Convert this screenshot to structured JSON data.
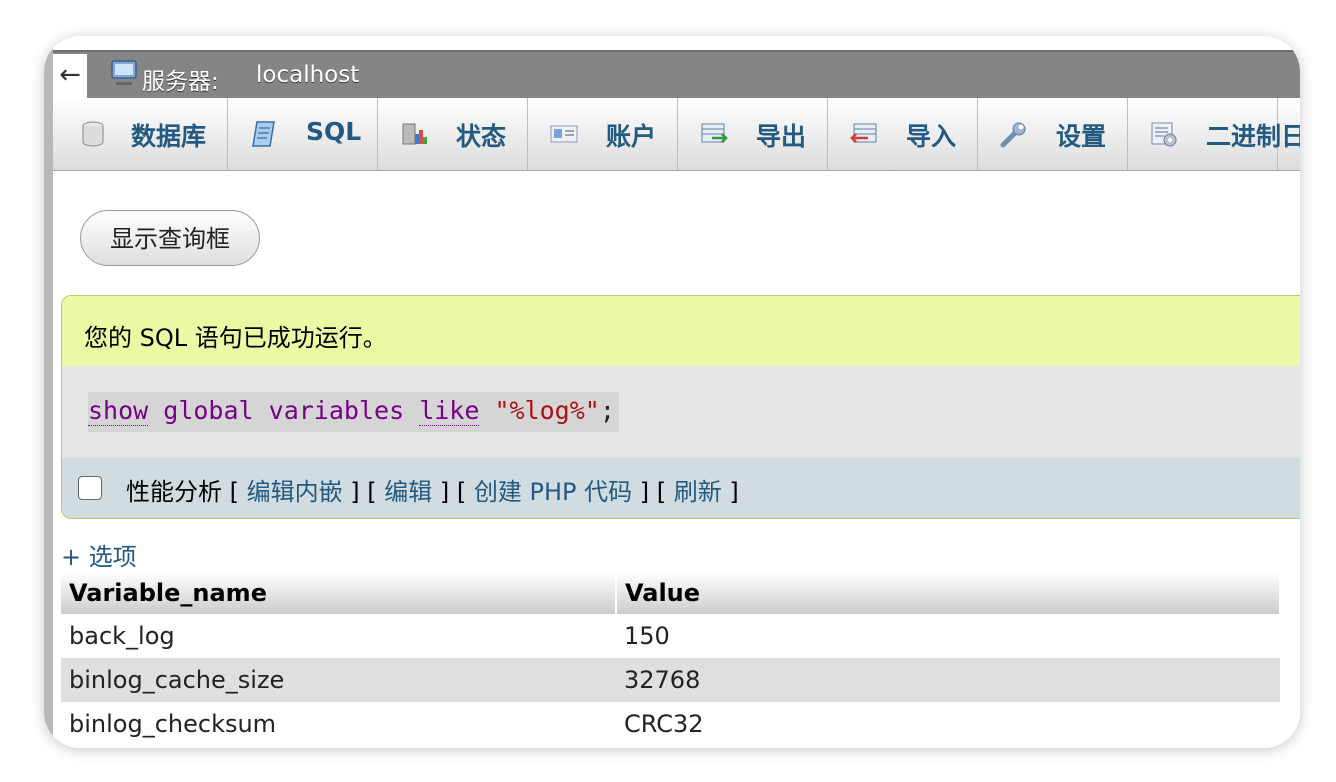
{
  "topbar": {
    "back_arrow": "←",
    "server_label": "服务器:",
    "server_name": "localhost"
  },
  "tabs": [
    {
      "label": "数据库",
      "icon": "database-icon"
    },
    {
      "label": "SQL",
      "icon": "sql-icon"
    },
    {
      "label": "状态",
      "icon": "status-icon"
    },
    {
      "label": "账户",
      "icon": "accounts-icon"
    },
    {
      "label": "导出",
      "icon": "export-icon"
    },
    {
      "label": "导入",
      "icon": "import-icon"
    },
    {
      "label": "设置",
      "icon": "settings-icon"
    },
    {
      "label": "二进制日",
      "icon": "binlog-icon"
    }
  ],
  "query_toggle_label": "显示查询框",
  "result": {
    "success_message": "您的 SQL 语句已成功运行。",
    "sql": {
      "show": "show",
      "global": "global",
      "variables": "variables",
      "like": "like",
      "pattern": "\"%log%\"",
      "terminator": ";"
    },
    "actions": {
      "profiling": "性能分析",
      "edit_inline": "编辑内嵌",
      "edit": "编辑",
      "create_php": "创建 PHP 代码",
      "refresh": "刷新"
    }
  },
  "options_link": "+ 选项",
  "table": {
    "headers": [
      "Variable_name",
      "Value"
    ],
    "rows": [
      [
        "back_log",
        "150"
      ],
      [
        "binlog_cache_size",
        "32768"
      ],
      [
        "binlog_checksum",
        "CRC32"
      ]
    ]
  },
  "colors": {
    "topbar": "#858585",
    "success_bg": "#ebf8a4",
    "link": "#235a81",
    "sql_keyword": "#770088",
    "sql_string": "#aa1111"
  }
}
